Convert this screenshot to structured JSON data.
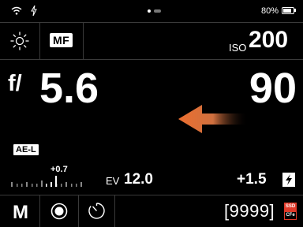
{
  "status_bar": {
    "wifi_icon": "wifi-icon",
    "flash_icon": "lightning-icon",
    "battery_percent": "80%",
    "battery_level": 0.8
  },
  "top_row": {
    "white_balance_icon": "sun-icon",
    "focus_mode": "MF",
    "iso_label": "ISO",
    "iso_value": "200"
  },
  "exposure": {
    "aperture_prefix": "f/",
    "aperture_value": "5.6",
    "shutter_value": "90",
    "arrow_icon": "left-arrow-icon"
  },
  "ae_lock": "AE-L",
  "ev_scale": {
    "offset_label": "+0.7",
    "ev_label": "EV",
    "ev_value": "12.0"
  },
  "flash_comp": {
    "value": "+1.5",
    "icon": "flash-icon"
  },
  "bottom_row": {
    "mode": "M",
    "record_icon": "record-icon",
    "timer_icon": "timer-icon",
    "shots_remaining": "[9999]",
    "card_icon": "card-icon",
    "card_top_label": "SSD",
    "card_bottom_label": "CFe"
  },
  "colors": {
    "background": "#000000",
    "divider": "#3a3a3a",
    "arrow": "#e8743a",
    "card_accent": "#e03a2a"
  }
}
